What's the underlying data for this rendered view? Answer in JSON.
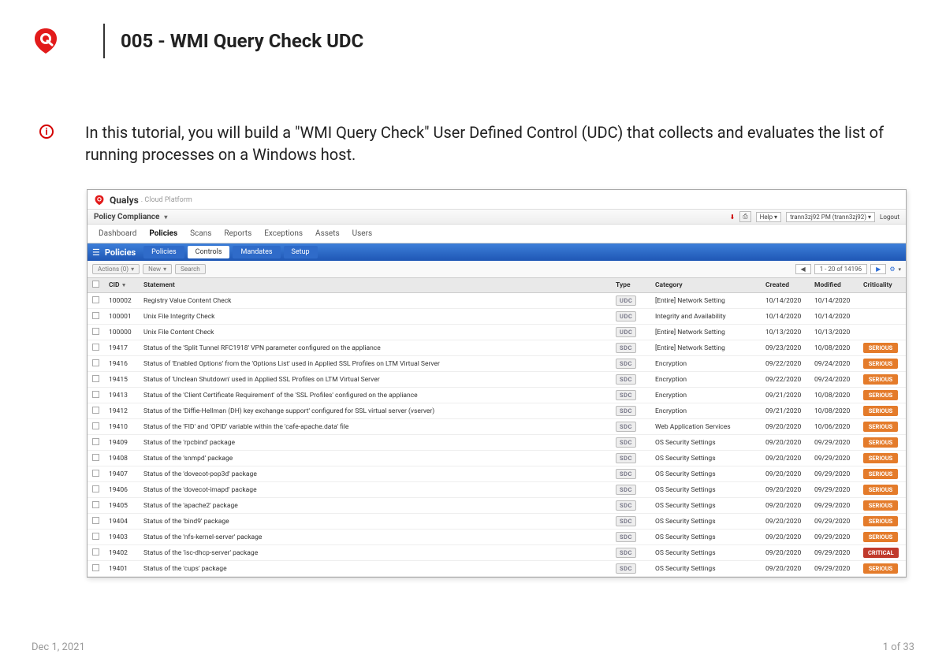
{
  "doc": {
    "title": "005 - WMI Query Check UDC",
    "intro": "In this tutorial, you will build a \"WMI Query Check\" User Defined Control (UDC) that collects and evaluates the list of running processes on a Windows host.",
    "date": "Dec 1, 2021",
    "page": "1 of 33"
  },
  "app": {
    "brand": "Qualys",
    "brand_sub": ". Cloud Platform",
    "module": "Policy Compliance",
    "topright": {
      "help": "Help",
      "user": "trann3zj92 PM (trann3zj92)",
      "logout": "Logout"
    },
    "nav": [
      "Dashboard",
      "Policies",
      "Scans",
      "Reports",
      "Exceptions",
      "Assets",
      "Users"
    ],
    "nav_active": "Policies",
    "blue_head": "Policies",
    "blue_tabs": [
      "Policies",
      "Controls",
      "Mandates",
      "Setup"
    ],
    "blue_active": "Controls",
    "toolbar": {
      "actions": "Actions (0)",
      "new": "New",
      "search": "Search",
      "pager": "1 - 20 of 14196"
    },
    "columns": [
      "CID",
      "Statement",
      "Type",
      "Category",
      "Created",
      "Modified",
      "Criticality"
    ]
  },
  "rows": [
    {
      "cid": "100002",
      "stmt": "Registry Value Content Check",
      "type": "UDC",
      "cat": "[Entire] Network Setting",
      "created": "10/14/2020",
      "modified": "10/14/2020",
      "crit": ""
    },
    {
      "cid": "100001",
      "stmt": "Unix File Integrity Check",
      "type": "UDC",
      "cat": "Integrity and Availability",
      "created": "10/14/2020",
      "modified": "10/14/2020",
      "crit": ""
    },
    {
      "cid": "100000",
      "stmt": "Unix File Content Check",
      "type": "UDC",
      "cat": "[Entire] Network Setting",
      "created": "10/13/2020",
      "modified": "10/13/2020",
      "crit": ""
    },
    {
      "cid": "19417",
      "stmt": "Status of the 'Split Tunnel RFC1918' VPN parameter configured on the appliance",
      "type": "SDC",
      "cat": "[Entire] Network Setting",
      "created": "09/23/2020",
      "modified": "10/08/2020",
      "crit": "SERIOUS"
    },
    {
      "cid": "19416",
      "stmt": "Status of 'Enabled Options' from the 'Options List' used in Applied SSL Profiles on LTM Virtual Server",
      "type": "SDC",
      "cat": "Encryption",
      "created": "09/22/2020",
      "modified": "09/24/2020",
      "crit": "SERIOUS"
    },
    {
      "cid": "19415",
      "stmt": "Status of 'Unclean Shutdown' used in Applied SSL Profiles on LTM Virtual Server",
      "type": "SDC",
      "cat": "Encryption",
      "created": "09/22/2020",
      "modified": "09/24/2020",
      "crit": "SERIOUS"
    },
    {
      "cid": "19413",
      "stmt": "Status of the 'Client Certificate Requirement' of the 'SSL Profiles' configured on the appliance",
      "type": "SDC",
      "cat": "Encryption",
      "created": "09/21/2020",
      "modified": "10/08/2020",
      "crit": "SERIOUS"
    },
    {
      "cid": "19412",
      "stmt": "Status of the 'Diffie-Hellman (DH) key exchange support' configured for SSL virtual server (vserver)",
      "type": "SDC",
      "cat": "Encryption",
      "created": "09/21/2020",
      "modified": "10/08/2020",
      "crit": "SERIOUS"
    },
    {
      "cid": "19410",
      "stmt": "Status of the 'FID' and 'OPID' variable within the 'cafe-apache.data' file",
      "type": "SDC",
      "cat": "Web Application Services",
      "created": "09/20/2020",
      "modified": "10/06/2020",
      "crit": "SERIOUS"
    },
    {
      "cid": "19409",
      "stmt": "Status of the 'rpcbind' package",
      "type": "SDC",
      "cat": "OS Security Settings",
      "created": "09/20/2020",
      "modified": "09/29/2020",
      "crit": "SERIOUS"
    },
    {
      "cid": "19408",
      "stmt": "Status of the 'snmpd' package",
      "type": "SDC",
      "cat": "OS Security Settings",
      "created": "09/20/2020",
      "modified": "09/29/2020",
      "crit": "SERIOUS"
    },
    {
      "cid": "19407",
      "stmt": "Status of the 'dovecot-pop3d' package",
      "type": "SDC",
      "cat": "OS Security Settings",
      "created": "09/20/2020",
      "modified": "09/29/2020",
      "crit": "SERIOUS"
    },
    {
      "cid": "19406",
      "stmt": "Status of the 'dovecot-imapd' package",
      "type": "SDC",
      "cat": "OS Security Settings",
      "created": "09/20/2020",
      "modified": "09/29/2020",
      "crit": "SERIOUS"
    },
    {
      "cid": "19405",
      "stmt": "Status of the 'apache2' package",
      "type": "SDC",
      "cat": "OS Security Settings",
      "created": "09/20/2020",
      "modified": "09/29/2020",
      "crit": "SERIOUS"
    },
    {
      "cid": "19404",
      "stmt": "Status of the 'bind9' package",
      "type": "SDC",
      "cat": "OS Security Settings",
      "created": "09/20/2020",
      "modified": "09/29/2020",
      "crit": "SERIOUS"
    },
    {
      "cid": "19403",
      "stmt": "Status of the 'nfs-kernel-server' package",
      "type": "SDC",
      "cat": "OS Security Settings",
      "created": "09/20/2020",
      "modified": "09/29/2020",
      "crit": "SERIOUS"
    },
    {
      "cid": "19402",
      "stmt": "Status of the 'isc-dhcp-server' package",
      "type": "SDC",
      "cat": "OS Security Settings",
      "created": "09/20/2020",
      "modified": "09/29/2020",
      "crit": "CRITICAL"
    },
    {
      "cid": "19401",
      "stmt": "Status of the 'cups' package",
      "type": "SDC",
      "cat": "OS Security Settings",
      "created": "09/20/2020",
      "modified": "09/29/2020",
      "crit": "SERIOUS"
    }
  ]
}
